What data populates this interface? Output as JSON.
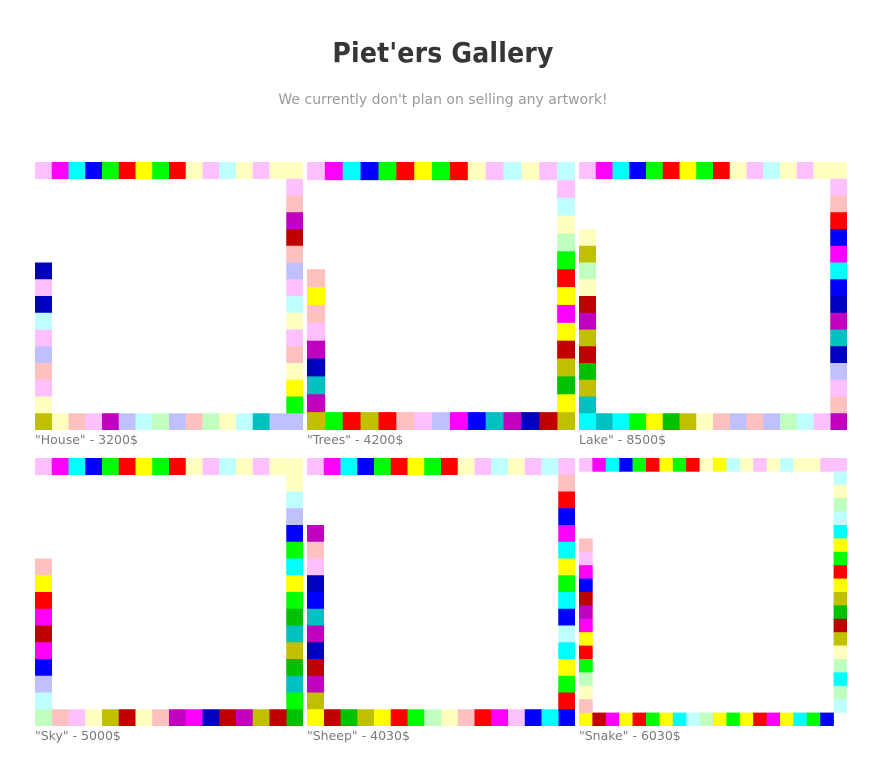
{
  "header": {
    "title": "Piet'ers Gallery",
    "subtitle": "We currently don't plan on selling any artwork!"
  },
  "palette": [
    "#ffc0ff",
    "#ff00ff",
    "#00ffff",
    "#0000ff",
    "#00ff00",
    "#ff0000",
    "#ffff00",
    "#c0c0ff",
    "#ffffc0",
    "#c0ffff",
    "#ffc0c0",
    "#c0ffc0",
    "#c000c0",
    "#c00000",
    "#c0c000",
    "#00c000",
    "#00c0c0",
    "#0000c0"
  ],
  "artworks": [
    {
      "caption": "\"House\" - 3200$",
      "n": 16,
      "top": [
        0,
        1,
        2,
        3,
        4,
        5,
        6,
        4,
        5,
        8,
        0,
        9,
        8,
        0,
        8,
        8
      ],
      "right": [
        0,
        10,
        12,
        13,
        10,
        7,
        0,
        9,
        8,
        0,
        10,
        8,
        6,
        4,
        7
      ],
      "bottom": [
        13,
        8,
        10,
        0,
        12,
        7,
        9,
        11,
        7,
        10,
        11,
        8,
        9,
        16,
        7
      ],
      "left": [
        null,
        null,
        null,
        null,
        null,
        17,
        0,
        17,
        9,
        0,
        7,
        10,
        0,
        8,
        14
      ]
    },
    {
      "caption": "\"Trees\" - 4200$",
      "n": 15,
      "top": [
        0,
        1,
        2,
        3,
        4,
        5,
        6,
        4,
        5,
        8,
        0,
        9,
        8,
        0,
        9
      ],
      "right": [
        0,
        9,
        8,
        11,
        4,
        5,
        6,
        1,
        6,
        13,
        14,
        15,
        6,
        14,
        12
      ],
      "bottom": [
        15,
        4,
        5,
        14,
        5,
        10,
        0,
        7,
        1,
        3,
        16,
        12,
        17,
        13
      ],
      "left": [
        null,
        null,
        null,
        null,
        null,
        10,
        6,
        10,
        0,
        12,
        17,
        16,
        12,
        14,
        13
      ]
    },
    {
      "caption": "Lake\" - 8500$",
      "n": 16,
      "top": [
        0,
        1,
        2,
        3,
        4,
        5,
        6,
        4,
        5,
        8,
        0,
        9,
        8,
        0,
        8,
        8
      ],
      "right": [
        0,
        10,
        5,
        3,
        1,
        2,
        3,
        17,
        12,
        16,
        17,
        7,
        0,
        10,
        12
      ],
      "bottom": [
        17,
        16,
        2,
        4,
        6,
        15,
        14,
        8,
        10,
        7,
        10,
        7,
        11,
        9,
        0
      ],
      "left": [
        null,
        null,
        null,
        8,
        14,
        11,
        8,
        13,
        12,
        14,
        13,
        15,
        14,
        16,
        2
      ]
    },
    {
      "caption": "\"Sky\" - 5000$",
      "n": 16,
      "top": [
        0,
        1,
        2,
        3,
        4,
        5,
        6,
        4,
        5,
        8,
        0,
        9,
        8,
        0,
        8,
        8
      ],
      "right": [
        8,
        9,
        7,
        3,
        4,
        2,
        6,
        4,
        15,
        16,
        14,
        15,
        16,
        4,
        15
      ],
      "bottom": [
        7,
        10,
        0,
        8,
        14,
        13,
        8,
        10,
        12,
        1,
        17,
        13,
        12,
        14,
        13
      ],
      "left": [
        null,
        null,
        null,
        null,
        null,
        10,
        6,
        5,
        1,
        13,
        1,
        3,
        7,
        9,
        11
      ]
    },
    {
      "caption": "\"Sheep\" - 4030$",
      "n": 16,
      "top": [
        0,
        1,
        2,
        3,
        4,
        5,
        6,
        4,
        5,
        8,
        0,
        9,
        8,
        0,
        9,
        0
      ],
      "right": [
        10,
        5,
        3,
        1,
        2,
        6,
        4,
        2,
        3,
        9,
        2,
        6,
        4,
        5,
        3
      ],
      "bottom": [
        6,
        13,
        15,
        14,
        6,
        5,
        4,
        11,
        8,
        10,
        5,
        1,
        0,
        3,
        2
      ],
      "left": [
        null,
        null,
        null,
        12,
        10,
        0,
        17,
        3,
        16,
        12,
        17,
        13,
        12,
        14,
        6
      ]
    },
    {
      "caption": "\"Snake\" - 6030$",
      "n": 20,
      "top": [
        0,
        1,
        2,
        3,
        4,
        5,
        6,
        4,
        5,
        8,
        6,
        9,
        8,
        0,
        8,
        9,
        8,
        8,
        0,
        0
      ],
      "right": [
        9,
        8,
        11,
        9,
        2,
        6,
        4,
        5,
        6,
        14,
        15,
        13,
        14,
        8,
        11,
        2,
        11,
        9
      ],
      "bottom": [
        6,
        13,
        1,
        6,
        5,
        4,
        6,
        2,
        9,
        11,
        6,
        4,
        6,
        5,
        1,
        6,
        2,
        4,
        3
      ],
      "left": [
        null,
        null,
        null,
        null,
        null,
        10,
        0,
        1,
        3,
        13,
        12,
        1,
        6,
        5,
        4,
        11,
        8,
        10
      ]
    }
  ]
}
